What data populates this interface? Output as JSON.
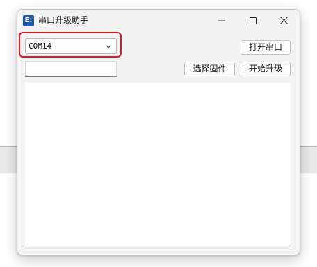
{
  "window": {
    "title": "串口升级助手",
    "icon": "app-icon",
    "icon_glyph": "E:"
  },
  "title_controls": {
    "minimize_icon": "minimize-icon",
    "maximize_icon": "maximize-icon",
    "close_icon": "close-icon"
  },
  "serial": {
    "port_selected": "COM14",
    "port_options": [
      "COM14"
    ],
    "open_button": "打开串口"
  },
  "firmware": {
    "path_value": "",
    "select_button": "选择固件",
    "upgrade_button": "开始升级"
  },
  "log": {
    "content": ""
  },
  "colors": {
    "highlight": "#e8131b",
    "app_icon_bg": "#1e5aa8",
    "window_bg": "#f3f3f3"
  }
}
